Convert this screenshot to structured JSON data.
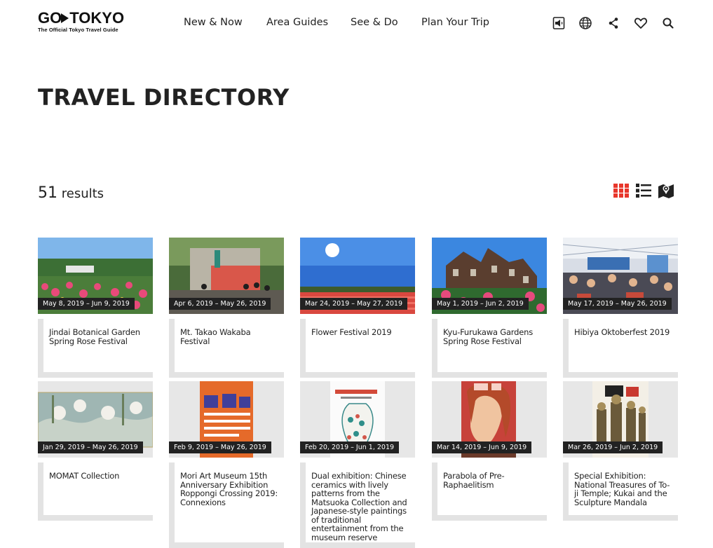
{
  "logo": {
    "main_left": "GO",
    "main_right": "TOKYO",
    "sub": "The Official Tokyo Travel Guide"
  },
  "nav": [
    "New & Now",
    "Area Guides",
    "See & Do",
    "Plan Your Trip"
  ],
  "header_icons": [
    "audio-guide-icon",
    "globe-icon",
    "share-icon",
    "heart-icon",
    "search-icon"
  ],
  "page_title": "TRAVEL DIRECTORY",
  "results": {
    "count": "51",
    "label": "results"
  },
  "view_toggles": [
    "grid-view-icon",
    "list-view-icon",
    "map-view-icon"
  ],
  "accent_color": "#e8372c",
  "cards": [
    {
      "date": "May 8, 2019 – Jun 9, 2019",
      "title": "Jindai Botanical Garden Spring Rose Festival"
    },
    {
      "date": "Apr 6, 2019 – May 26, 2019",
      "title": "Mt. Takao Wakaba Festival"
    },
    {
      "date": "Mar 24, 2019 – May 27, 2019",
      "title": "Flower Festival 2019"
    },
    {
      "date": "May 1, 2019 – Jun 2, 2019",
      "title": "Kyu-Furukawa Gardens Spring Rose Festival"
    },
    {
      "date": "May 17, 2019 – May 26, 2019",
      "title": "Hibiya Oktoberfest 2019"
    },
    {
      "date": "Jan 29, 2019 – May 26, 2019",
      "title": "MOMAT Collection"
    },
    {
      "date": "Feb 9, 2019 – May 26, 2019",
      "title": "Mori Art Museum 15th Anniversary Exhibition Roppongi Crossing 2019: Connexions"
    },
    {
      "date": "Feb 20, 2019 – Jun 1, 2019",
      "title": "Dual exhibition: Chinese ceramics with lively patterns from the Matsuoka Collection and Japanese-style paintings of traditional entertainment from the museum reserve"
    },
    {
      "date": "Mar 14, 2019 – Jun 9, 2019",
      "title": "Parabola of Pre-Raphaelitism"
    },
    {
      "date": "Mar 26, 2019 – Jun 2, 2019",
      "title": "Special Exhibition: National Treasures of To-ji Temple; Kukai and the Sculpture Mandala"
    }
  ]
}
